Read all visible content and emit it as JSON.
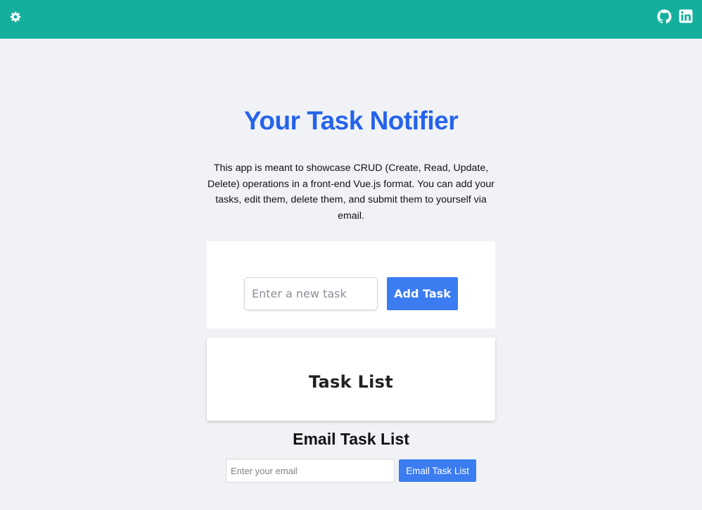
{
  "header": {
    "settings_icon": "gear-icon",
    "github_icon": "github-icon",
    "linkedin_icon": "linkedin-icon",
    "bar_color": "#14b09e"
  },
  "main": {
    "title": "Your Task Notifier",
    "description": "This app is meant to showcase CRUD (Create, Read, Update, Delete) operations in a front-end Vue.js format. You can add your tasks, edit them, delete them, and submit them to yourself via email.",
    "accent_color": "#2563eb"
  },
  "add_task": {
    "placeholder": "Enter a new task",
    "value": "",
    "button_label": "Add Task",
    "button_color": "#3b7cf1"
  },
  "task_list": {
    "title": "Task List",
    "items": []
  },
  "email": {
    "title": "Email Task List",
    "placeholder": "Enter your email",
    "value": "",
    "button_label": "Email Task List"
  }
}
